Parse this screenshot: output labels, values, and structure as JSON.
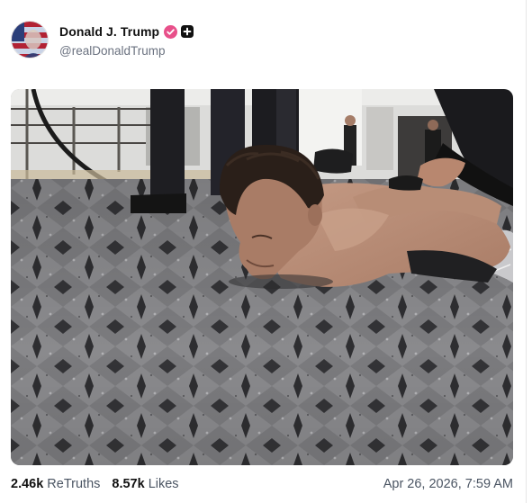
{
  "post": {
    "author": {
      "display_name": "Donald J. Trump",
      "handle": "@realDonaldTrump",
      "avatar_icon": "flag-portrait-avatar",
      "verified_icon": "verified-check-icon",
      "badge_icon": "plus-badge-icon"
    },
    "media": {
      "type": "photo"
    },
    "stats": {
      "retruths_count": "2.46k",
      "retruths_label": "ReTruths",
      "likes_count": "8.57k",
      "likes_label": "Likes"
    },
    "timestamp": "Apr 26, 2026, 7:59 AM"
  },
  "colors": {
    "verified_badge": "#e8508a",
    "plus_badge": "#111111",
    "muted_text": "#6b7280"
  }
}
